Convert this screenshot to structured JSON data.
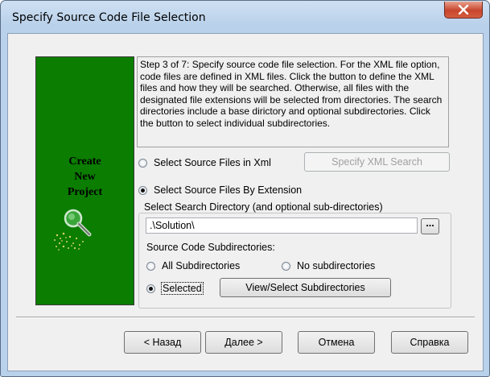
{
  "window": {
    "title": "Specify Source Code File Selection"
  },
  "side_panel": {
    "text": "Create\nNew\nProject",
    "icon": "magnifier-icon"
  },
  "step_text": "Step 3 of 7: Specify source code file selection. For the XML file option, code files are defined in XML files. Click the button to define the XML files and how they will be searched. Otherwise, all files with the designated file extensions will be selected from directories. The search directories include a base dirictory and optional subdirectories. Click the button to select individual subdirectories.",
  "options": {
    "xml_label": "Select Source Files in Xml",
    "xml_selected": false,
    "extension_label": "Select Source Files By Extension",
    "extension_selected": true
  },
  "specify_xml_button": "Specify XML Search",
  "directory_group": {
    "legend": "Select Search Directory (and optional sub-directories)",
    "path_value": ".\\Solution\\",
    "browse_label": "..."
  },
  "subdirectories": {
    "label": "Source Code Subdirectories:",
    "all_label": "All Subdirectories",
    "none_label": "No subdirectories",
    "selected_label": "Selected",
    "selected_choice": "Selected",
    "view_button": "View/Select Subdirectories"
  },
  "footer": {
    "back": "< Назад",
    "next": "Далее >",
    "cancel": "Отмена",
    "help": "Справка"
  }
}
